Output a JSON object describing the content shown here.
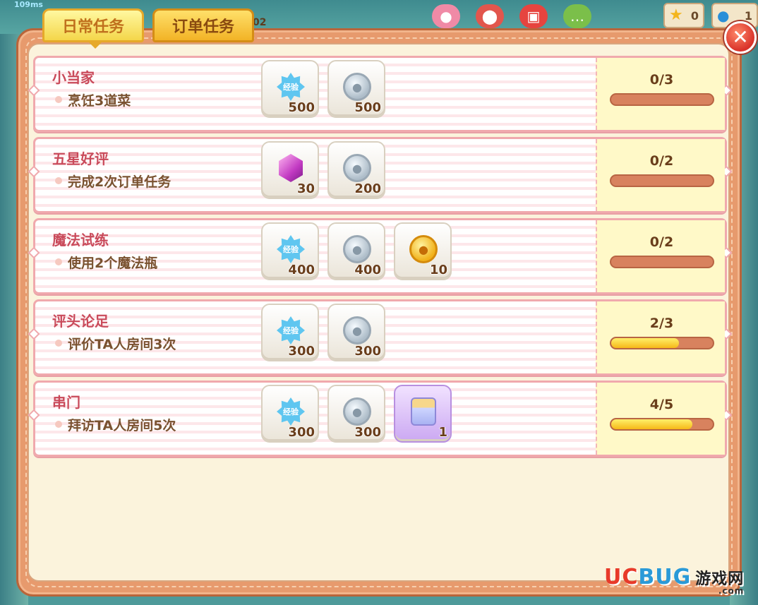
{
  "status": {
    "ping": "109ms",
    "stars": "0",
    "friends": "1",
    "level_fragment": "02"
  },
  "tabs": [
    {
      "label": "日常任务",
      "active": true
    },
    {
      "label": "订单任务",
      "active": false
    }
  ],
  "close_label": "✕",
  "colors": {
    "title_red": "#c94a5a",
    "desc_brown": "#7a5230",
    "progress_fill": "#f6b818",
    "progress_track": "#d8825e"
  },
  "tasks": [
    {
      "title": "小当家",
      "desc": "烹饪3道菜",
      "progress_text": "0/3",
      "progress": 0,
      "rewards": [
        {
          "icon": "exp-badge-icon",
          "icon_text": "经验",
          "amount": "500"
        },
        {
          "icon": "silver-coin-icon",
          "icon_text": "",
          "amount": "500"
        }
      ]
    },
    {
      "title": "五星好评",
      "desc": "完成2次订单任务",
      "progress_text": "0/2",
      "progress": 0,
      "rewards": [
        {
          "icon": "gem-icon",
          "icon_text": "",
          "amount": "30"
        },
        {
          "icon": "silver-coin-icon",
          "icon_text": "",
          "amount": "200"
        }
      ]
    },
    {
      "title": "魔法试练",
      "desc": "使用2个魔法瓶",
      "progress_text": "0/2",
      "progress": 0,
      "rewards": [
        {
          "icon": "exp-badge-icon",
          "icon_text": "经验",
          "amount": "400"
        },
        {
          "icon": "silver-coin-icon",
          "icon_text": "",
          "amount": "400"
        },
        {
          "icon": "gold-coin-icon",
          "icon_text": "",
          "amount": "10"
        }
      ]
    },
    {
      "title": "评头论足",
      "desc": "评价TA人房间3次",
      "progress_text": "2/3",
      "progress": 0.667,
      "rewards": [
        {
          "icon": "exp-badge-icon",
          "icon_text": "经验",
          "amount": "300"
        },
        {
          "icon": "silver-coin-icon",
          "icon_text": "",
          "amount": "300"
        }
      ]
    },
    {
      "title": "串门",
      "desc": "拜访TA人房间5次",
      "progress_text": "4/5",
      "progress": 0.8,
      "rewards": [
        {
          "icon": "exp-badge-icon",
          "icon_text": "经验",
          "amount": "300"
        },
        {
          "icon": "silver-coin-icon",
          "icon_text": "",
          "amount": "300"
        },
        {
          "icon": "potion-icon",
          "icon_text": "",
          "amount": "1"
        }
      ]
    }
  ],
  "watermark": {
    "uc": "UC",
    "bug": "BUG",
    "cn": "游戏网",
    "com": ".com"
  }
}
